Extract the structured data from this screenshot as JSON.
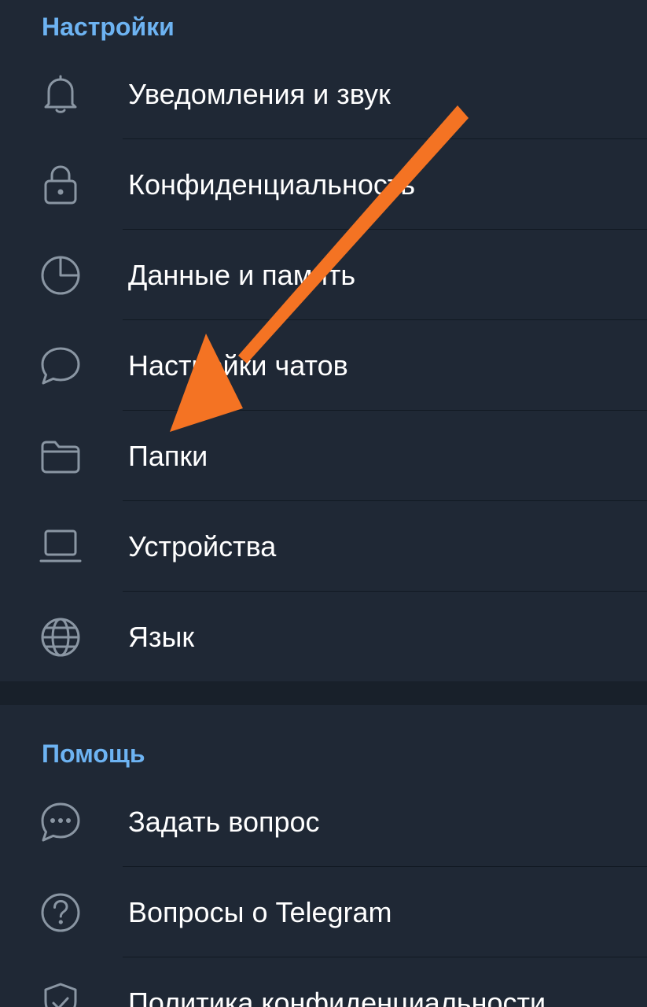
{
  "settings": {
    "title": "Настройки",
    "items": [
      {
        "label": "Уведомления и звук",
        "icon": "bell-icon"
      },
      {
        "label": "Конфиденциальность",
        "icon": "lock-icon"
      },
      {
        "label": "Данные и память",
        "icon": "pie-chart-icon"
      },
      {
        "label": "Настройки чатов",
        "icon": "chat-bubble-icon"
      },
      {
        "label": "Папки",
        "icon": "folder-icon"
      },
      {
        "label": "Устройства",
        "icon": "laptop-icon"
      },
      {
        "label": "Язык",
        "icon": "globe-icon"
      }
    ]
  },
  "help": {
    "title": "Помощь",
    "items": [
      {
        "label": "Задать вопрос",
        "icon": "chat-dots-icon"
      },
      {
        "label": "Вопросы о Telegram",
        "icon": "question-circle-icon"
      },
      {
        "label": "Политика конфиденциальности",
        "icon": "shield-check-icon"
      }
    ]
  },
  "colors": {
    "background": "#1f2835",
    "section_title": "#6db3f2",
    "icon": "#8a96a3",
    "text": "#ffffff",
    "annotation_arrow": "#f47323"
  },
  "annotation": {
    "type": "arrow",
    "points_to": "settings-item-folders"
  }
}
